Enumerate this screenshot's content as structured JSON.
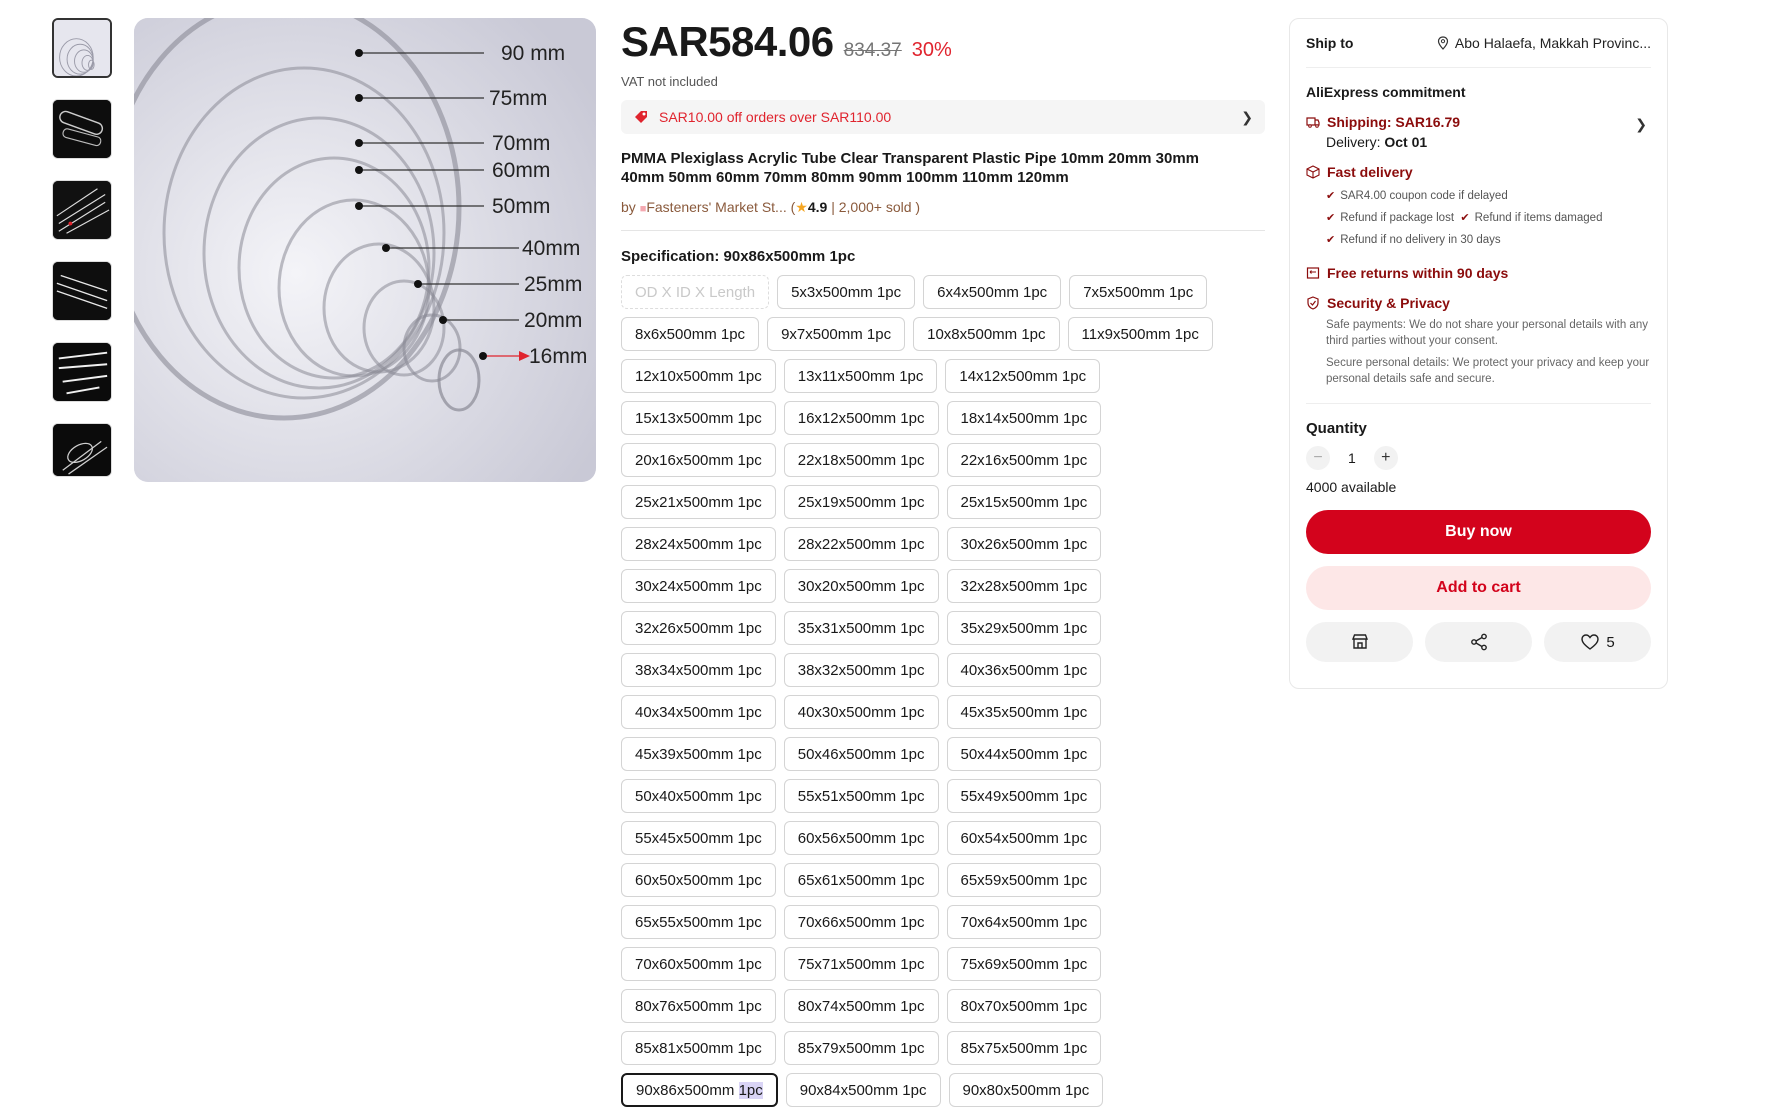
{
  "gallery": {
    "thumbnails": [
      "thumbnail-1",
      "thumbnail-2",
      "thumbnail-3",
      "thumbnail-4",
      "thumbnail-5",
      "thumbnail-6"
    ],
    "main_image_labels": [
      "90 mm",
      "75mm",
      "70mm",
      "60mm",
      "50mm",
      "40mm",
      "25mm",
      "20mm",
      "16mm"
    ]
  },
  "product": {
    "price": "SAR584.06",
    "original_price": "834.37",
    "discount": "30%",
    "vat_note": "VAT not included",
    "coupon_text": "SAR10.00 off orders over SAR110.00",
    "title": "PMMA Plexiglass Acrylic Tube Clear Transparent Plastic Pipe 10mm 20mm 30mm 40mm 50mm 60mm 70mm 80mm 90mm 100mm 110mm 120mm",
    "seller_prefix": "by",
    "seller_name": "Fasteners' Market St...",
    "rating": "4.9",
    "sold": "2,000+ sold"
  },
  "specification": {
    "label": "Specification: 90x86x500mm 1pc",
    "disabled_option": "OD X ID X Length",
    "selected_main": "90x86x500mm",
    "selected_suffix": "1pc",
    "options": [
      "5x3x500mm 1pc",
      "6x4x500mm 1pc",
      "7x5x500mm 1pc",
      "8x6x500mm 1pc",
      "9x7x500mm 1pc",
      "10x8x500mm 1pc",
      "11x9x500mm 1pc",
      "12x10x500mm 1pc",
      "13x11x500mm 1pc",
      "14x12x500mm 1pc",
      "15x13x500mm 1pc",
      "16x12x500mm 1pc",
      "18x14x500mm 1pc",
      "20x16x500mm 1pc",
      "22x18x500mm 1pc",
      "22x16x500mm 1pc",
      "25x21x500mm 1pc",
      "25x19x500mm 1pc",
      "25x15x500mm 1pc",
      "28x24x500mm 1pc",
      "28x22x500mm 1pc",
      "30x26x500mm 1pc",
      "30x24x500mm 1pc",
      "30x20x500mm 1pc",
      "32x28x500mm 1pc",
      "32x26x500mm 1pc",
      "35x31x500mm 1pc",
      "35x29x500mm 1pc",
      "38x34x500mm 1pc",
      "38x32x500mm 1pc",
      "40x36x500mm 1pc",
      "40x34x500mm 1pc",
      "40x30x500mm 1pc",
      "45x35x500mm 1pc",
      "45x39x500mm 1pc",
      "50x46x500mm 1pc",
      "50x44x500mm 1pc",
      "50x40x500mm 1pc",
      "55x51x500mm 1pc",
      "55x49x500mm 1pc",
      "55x45x500mm 1pc",
      "60x56x500mm 1pc",
      "60x54x500mm 1pc",
      "60x50x500mm 1pc",
      "65x61x500mm 1pc",
      "65x59x500mm 1pc",
      "65x55x500mm 1pc",
      "70x66x500mm 1pc",
      "70x64x500mm 1pc",
      "70x60x500mm 1pc",
      "75x71x500mm 1pc",
      "75x69x500mm 1pc",
      "80x76x500mm 1pc",
      "80x74x500mm 1pc",
      "80x70x500mm 1pc",
      "85x81x500mm 1pc",
      "85x79x500mm 1pc",
      "85x75x500mm 1pc",
      "SELECTED",
      "90x84x500mm 1pc",
      "90x80x500mm 1pc"
    ]
  },
  "panel": {
    "ship_to_label": "Ship to",
    "ship_to_location": "Abo Halaefa, Makkah Provinc...",
    "commitment_title": "AliExpress commitment",
    "shipping": "Shipping: SAR16.79",
    "delivery_label": "Delivery:",
    "delivery_date": "Oct 01",
    "fast_delivery": "Fast delivery",
    "fast_checks": [
      "SAR4.00 coupon code if delayed",
      "Refund if package lost",
      "Refund if items damaged",
      "Refund if no delivery in 30 days"
    ],
    "free_returns": "Free returns within 90 days",
    "security": "Security & Privacy",
    "security_text_1": "Safe payments: We do not share your personal details with any third parties without your consent.",
    "security_text_2": "Secure personal details: We protect your privacy and keep your personal details safe and secure.",
    "quantity_label": "Quantity",
    "quantity_value": "1",
    "available": "4000 available",
    "buy_now": "Buy now",
    "add_to_cart": "Add to cart",
    "wishlist_count": "5"
  },
  "colors": {
    "accent_red": "#d3031c",
    "discount_red": "#e0242e",
    "commit_dark_red": "#8b0c0c"
  }
}
